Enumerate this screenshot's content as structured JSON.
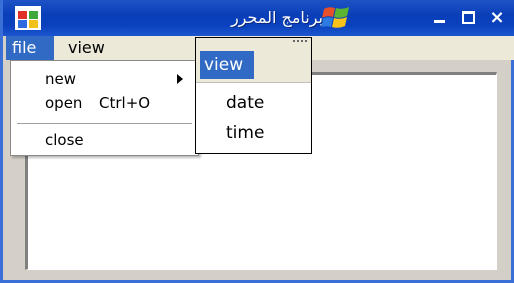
{
  "window": {
    "title": "برنامج المحرر",
    "controls": {
      "minimize": "minimize",
      "maximize": "maximize",
      "close": "×"
    }
  },
  "menubar": {
    "items": [
      {
        "label": "file"
      },
      {
        "label": "view"
      }
    ]
  },
  "file_menu": {
    "items": [
      {
        "label": "new",
        "has_submenu": true
      },
      {
        "label": "open",
        "shortcut": "Ctrl+O"
      },
      {
        "label": "close"
      }
    ]
  },
  "view_panel": {
    "header": "view",
    "options": [
      {
        "label": "date"
      },
      {
        "label": "time"
      }
    ]
  },
  "colors": {
    "titlebar": "#0a3fb8",
    "highlight": "#316ac5",
    "menu_bg": "#ece9d8",
    "window_bg": "#d4d0c8"
  },
  "icons": [
    "app-icon",
    "windows-logo-icon",
    "minimize-icon",
    "maximize-icon",
    "close-icon",
    "submenu-arrow-icon"
  ]
}
